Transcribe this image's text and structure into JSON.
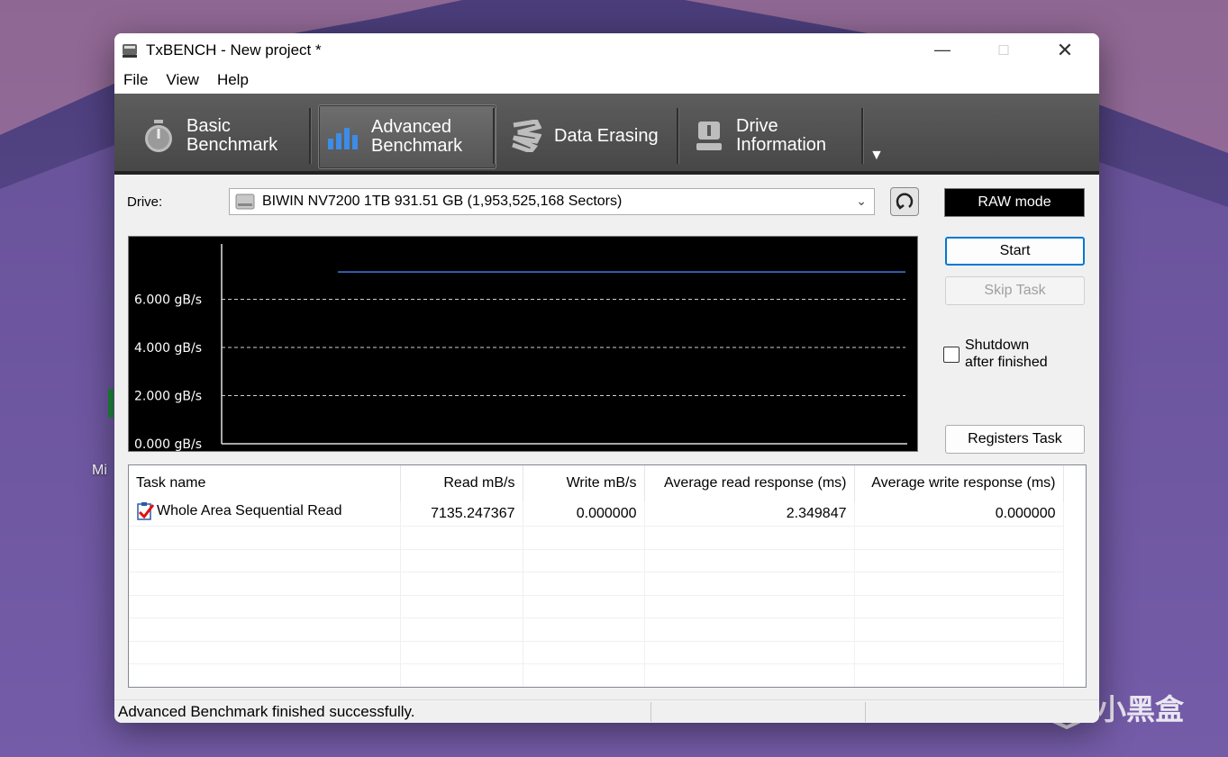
{
  "window": {
    "title": "TxBENCH - New project *"
  },
  "menu": [
    "File",
    "View",
    "Help"
  ],
  "tabs": {
    "basic": "Basic\nBenchmark",
    "advanced": "Advanced\nBenchmark",
    "erasing": "Data Erasing",
    "drive": "Drive\nInformation"
  },
  "drive": {
    "label": "Drive:",
    "selected": "BIWIN NV7200 1TB  931.51 GB (1,953,525,168 Sectors)"
  },
  "raw_mode": "RAW mode",
  "buttons": {
    "start": "Start",
    "skip": "Skip Task",
    "registers": "Registers Task"
  },
  "shutdown": {
    "label": "Shutdown\nafter finished",
    "checked": false
  },
  "chart_data": {
    "type": "line",
    "y_unit": "gB/s",
    "yticks": [
      {
        "value": 0,
        "label": "0.000 gB/s"
      },
      {
        "value": 2000,
        "label": "2.000 gB/s"
      },
      {
        "value": 4000,
        "label": "4.000 gB/s"
      },
      {
        "value": 6000,
        "label": "6.000 gB/s"
      }
    ],
    "ylim": [
      0,
      8300
    ],
    "xlim": [
      0,
      100
    ],
    "grid": true,
    "series": [
      {
        "color": "#3f7de0",
        "x": [
          17,
          100
        ],
        "y": [
          7135,
          7135
        ]
      }
    ]
  },
  "table": {
    "columns": [
      "Task name",
      "Read mB/s",
      "Write mB/s",
      "Average read response (ms)",
      "Average write response (ms)"
    ],
    "rows": [
      [
        "Whole Area Sequential Read",
        "7135.247367",
        "0.000000",
        "2.349847",
        "0.000000"
      ]
    ]
  },
  "status": {
    "text": "Advanced Benchmark finished successfully."
  },
  "desktop": {
    "label": "Mi",
    "watermark": "小黑盒"
  }
}
